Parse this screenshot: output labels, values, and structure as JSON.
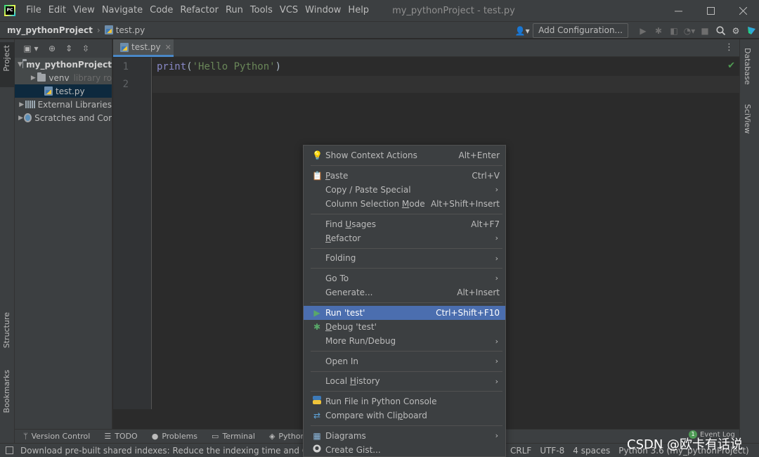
{
  "app": {
    "window_title": "my_pythonProject - test.py",
    "menu": [
      "File",
      "Edit",
      "View",
      "Navigate",
      "Code",
      "Refactor",
      "Run",
      "Tools",
      "VCS",
      "Window",
      "Help"
    ]
  },
  "navbar": {
    "project": "my_pythonProject",
    "file": "test.py",
    "add_config": "Add Configuration..."
  },
  "left_tabs": {
    "project": "Project",
    "structure": "Structure",
    "bookmarks": "Bookmarks"
  },
  "right_tabs": {
    "database": "Database",
    "sciview": "SciView"
  },
  "project_tree": {
    "root": "my_pythonProject",
    "venv": "venv",
    "venv_hint": "library ro",
    "file": "test.py",
    "external": "External Libraries",
    "scratches": "Scratches and Cor"
  },
  "editor": {
    "tab": "test.py",
    "line_numbers": [
      "1",
      "2"
    ],
    "code": {
      "fn": "print",
      "open": "(",
      "str": "'Hello Python'",
      "close": ")"
    }
  },
  "context_menu": {
    "show_actions": {
      "label": "Show Context Actions",
      "shortcut": "Alt+Enter"
    },
    "paste": {
      "u": "P",
      "rest": "aste",
      "shortcut": "Ctrl+V"
    },
    "copy_paste_special": "Copy / Paste Special",
    "column_selection": {
      "pre": "Column Selection ",
      "u": "M",
      "rest": "ode",
      "shortcut": "Alt+Shift+Insert"
    },
    "find_usages": {
      "pre": "Find ",
      "u": "U",
      "rest": "sages",
      "shortcut": "Alt+F7"
    },
    "refactor": {
      "u": "R",
      "rest": "efactor"
    },
    "folding": "Folding",
    "go_to": "Go To",
    "generate": {
      "label": "Generate...",
      "shortcut": "Alt+Insert"
    },
    "run": {
      "label": "Run 'test'",
      "shortcut": "Ctrl+Shift+F10"
    },
    "debug": {
      "u": "D",
      "rest": "ebug 'test'"
    },
    "more_run": "More Run/Debug",
    "open_in": "Open In",
    "local_history": {
      "pre": "Local ",
      "u": "H",
      "rest": "istory"
    },
    "run_console": "Run File in Python Console",
    "compare_clipboard": {
      "pre": "Compare with Cli",
      "u": "p",
      "rest": "board"
    },
    "diagrams": "Diagrams",
    "create_gist": "Create Gist..."
  },
  "tool_windows": [
    "Version Control",
    "TODO",
    "Problems",
    "Terminal",
    "Python P"
  ],
  "status": {
    "message": "Download pre-built shared indexes: Reduce the indexing time and CPU loa",
    "crlf": "CRLF",
    "encoding": "UTF-8",
    "indent": "4 spaces",
    "interpreter": "Python 3.6 (my_pythonProject)",
    "event_log": "Event Log",
    "event_count": "1"
  },
  "watermark": "CSDN @欧卡有话说",
  "colors": {
    "accent": "#4b6eaf",
    "background": "#2b2b2b",
    "panel": "#3c3f41",
    "string": "#6a8759",
    "builtin": "#8888c6"
  }
}
